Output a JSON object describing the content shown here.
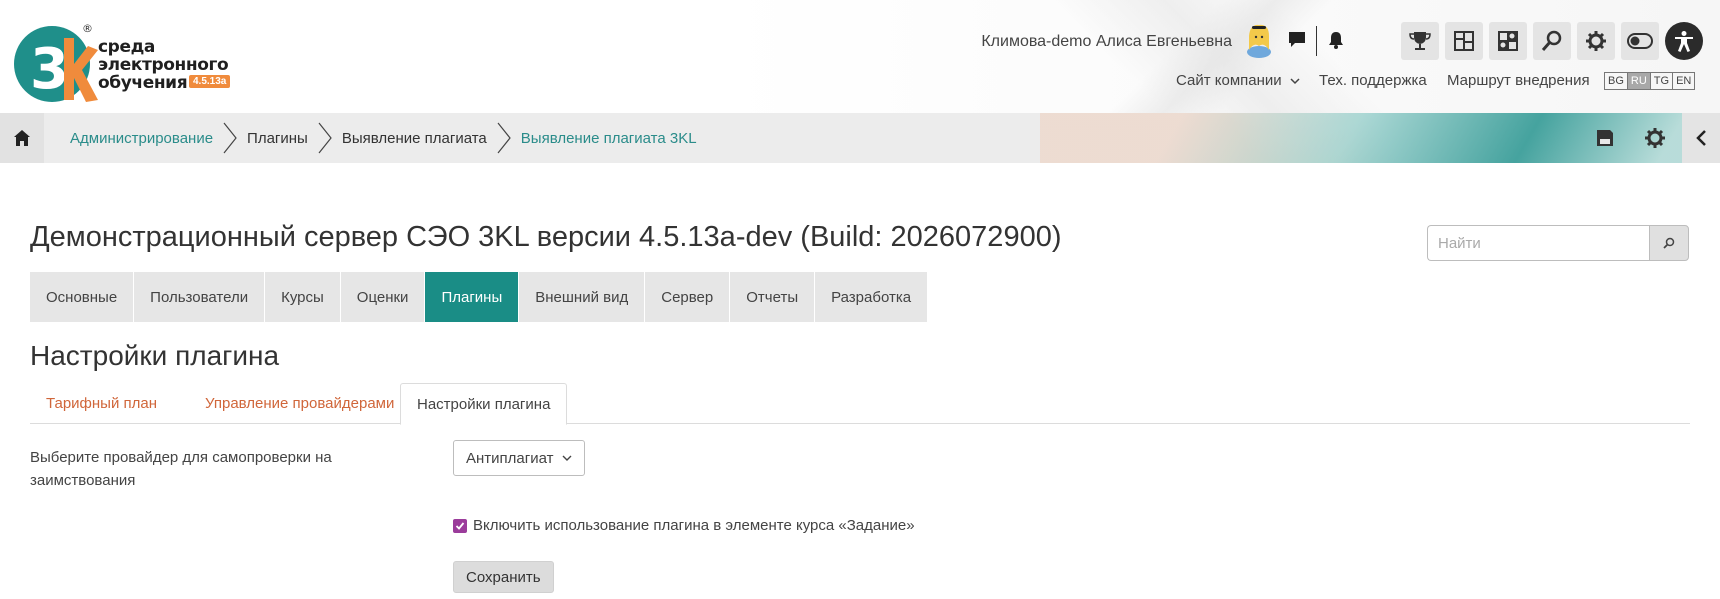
{
  "logo": {
    "text_line1": "среда",
    "text_line2": "электронного",
    "text_line3": "обучения",
    "version": "4.5.13a"
  },
  "header": {
    "user_name": "Климова-demo Алиса Евгеньевна",
    "links": [
      "Сайт компании",
      "Тех. поддержка",
      "Маршрут внедрения"
    ],
    "languages": [
      "BG",
      "RU",
      "TG",
      "EN"
    ],
    "active_language": "RU"
  },
  "breadcrumb": {
    "items": [
      "Администрирование",
      "Плагины",
      "Выявление плагиата",
      "Выявление плагиата 3KL"
    ]
  },
  "page": {
    "title": "Демонстрационный сервер СЭО 3KL версии 4.5.13a-dev (Build: 2026072900)",
    "search_placeholder": "Найти"
  },
  "admin_tabs": [
    "Основные",
    "Пользователи",
    "Курсы",
    "Оценки",
    "Плагины",
    "Внешний вид",
    "Сервер",
    "Отчеты",
    "Разработка"
  ],
  "active_admin_tab": "Плагины",
  "section": {
    "title": "Настройки плагина",
    "tabs": [
      "Тарифный план",
      "Управление провайдерами",
      "Настройки плагина"
    ],
    "active_tab": "Настройки плагина"
  },
  "form": {
    "provider_label": "Выберите провайдер для самопроверки на заимствования",
    "provider_value": "Антиплагиат",
    "enable_label": "Включить использование плагина в элементе курса «Задание»",
    "enable_checked": true,
    "save_label": "Сохранить"
  },
  "colors": {
    "accent_teal": "#1a8d86",
    "link_teal": "#2a8c8a",
    "tab_orange": "#d0663a",
    "checkbox_purple": "#9b3c9b",
    "logo_orange": "#f08b3c"
  }
}
